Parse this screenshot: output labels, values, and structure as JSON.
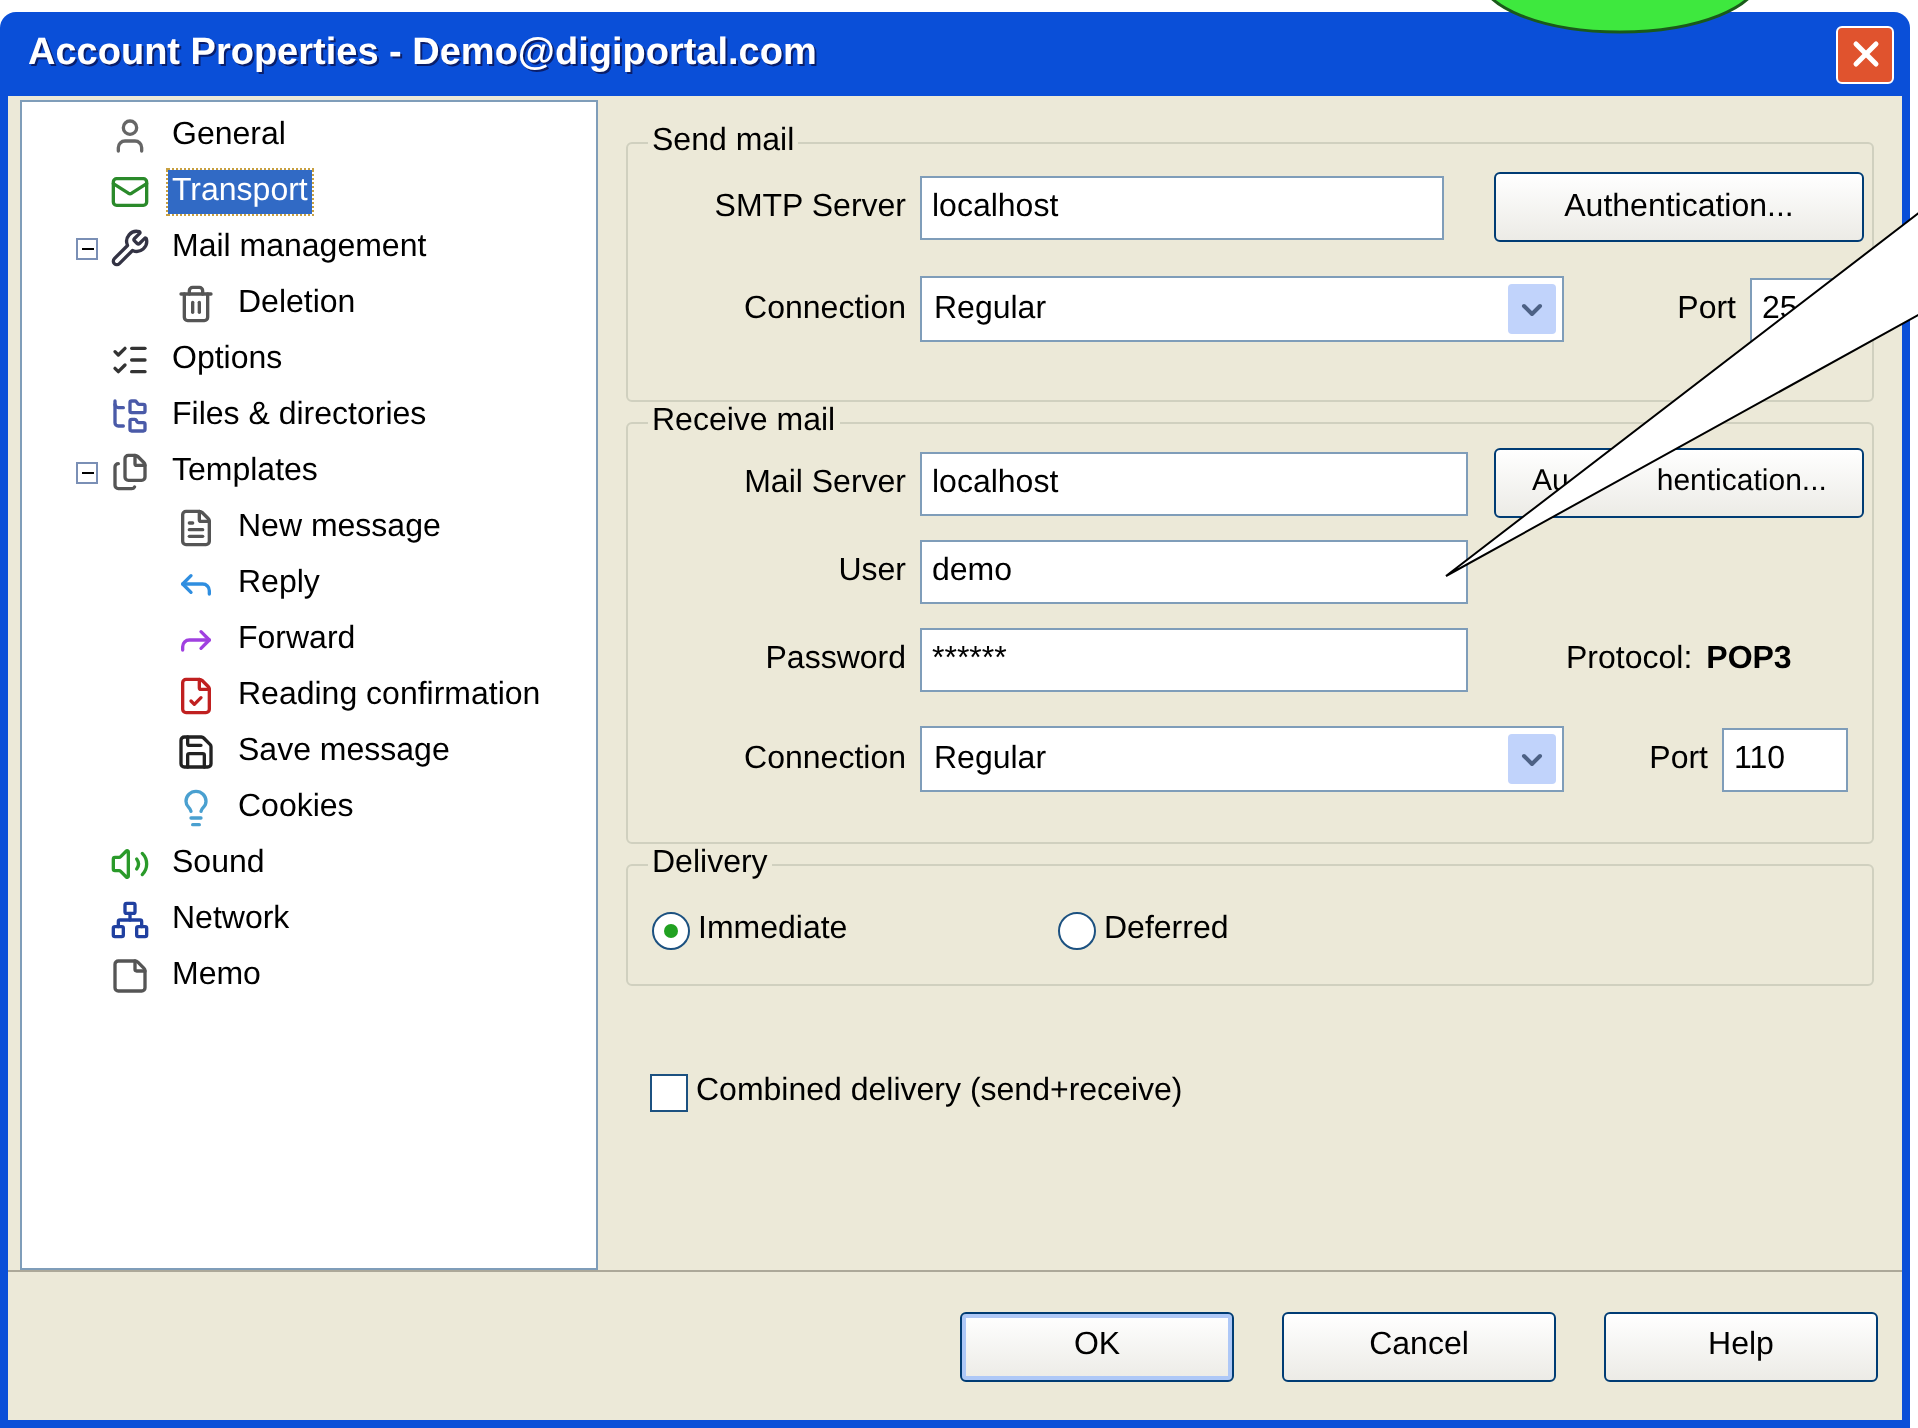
{
  "window": {
    "title": "Account Properties - Demo@digiportal.com"
  },
  "tree": [
    {
      "label": "General",
      "selected": false
    },
    {
      "label": "Transport",
      "selected": true
    },
    {
      "label": "Mail management",
      "selected": false,
      "expanded": true,
      "children": [
        {
          "label": "Deletion",
          "selected": false
        }
      ]
    },
    {
      "label": "Options",
      "selected": false
    },
    {
      "label": "Files & directories",
      "selected": false
    },
    {
      "label": "Templates",
      "selected": false,
      "expanded": true,
      "children": [
        {
          "label": "New message",
          "selected": false
        },
        {
          "label": "Reply",
          "selected": false
        },
        {
          "label": "Forward",
          "selected": false
        },
        {
          "label": "Reading confirmation",
          "selected": false
        },
        {
          "label": "Save message",
          "selected": false
        },
        {
          "label": "Cookies",
          "selected": false
        }
      ]
    },
    {
      "label": "Sound",
      "selected": false
    },
    {
      "label": "Network",
      "selected": false
    },
    {
      "label": "Memo",
      "selected": false
    }
  ],
  "send_mail": {
    "title": "Send mail",
    "server_label": "SMTP Server",
    "server": "localhost",
    "auth_button": "Authentication...",
    "connection_label": "Connection",
    "connection": "Regular",
    "port_label": "Port",
    "port": "25"
  },
  "receive_mail": {
    "title": "Receive mail",
    "server_label": "Mail Server",
    "server": "localhost",
    "auth_button_parts": [
      "Au",
      "hentication..."
    ],
    "user_label": "User",
    "user": "demo",
    "password_label": "Password",
    "password": "******",
    "protocol_label": "Protocol:",
    "protocol": "POP3",
    "connection_label": "Connection",
    "connection": "Regular",
    "port_label": "Port",
    "port": "110"
  },
  "delivery": {
    "title": "Delivery",
    "options": [
      {
        "label": "Immediate",
        "selected": true
      },
      {
        "label": "Deferred",
        "selected": false
      }
    ]
  },
  "combined_delivery": {
    "label": "Combined delivery (send+receive)",
    "checked": false
  },
  "buttons": [
    {
      "label": "OK",
      "default": true
    },
    {
      "label": "Cancel",
      "default": false
    },
    {
      "label": "Help",
      "default": false
    }
  ]
}
